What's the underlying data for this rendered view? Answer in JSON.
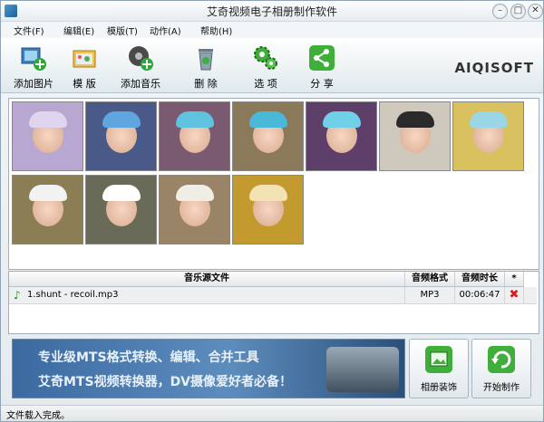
{
  "window": {
    "title": "艾奇视频电子相册制作软件"
  },
  "menu": [
    "文件(F)",
    "编辑(E)",
    "模版(T)",
    "动作(A)",
    "帮助(H)"
  ],
  "toolbar": [
    {
      "label": "添加图片",
      "icon": "add-photo-icon"
    },
    {
      "label": "模 版",
      "icon": "template-icon"
    },
    {
      "label": "添加音乐",
      "icon": "add-music-icon"
    },
    {
      "label": "删 除",
      "icon": "recycle-bin-icon"
    },
    {
      "label": "选 项",
      "icon": "gears-icon"
    },
    {
      "label": "分 享",
      "icon": "share-icon"
    }
  ],
  "brand": "AIQISOFT",
  "photos": [
    {
      "bg": "#b8a7d1",
      "hat": "#e0d4ef"
    },
    {
      "bg": "#4a5a88",
      "hat": "#5fa6e0"
    },
    {
      "bg": "#7a5a70",
      "hat": "#5fc2de"
    },
    {
      "bg": "#8a7a5a",
      "hat": "#4cb8d8"
    },
    {
      "bg": "#5e3f6a",
      "hat": "#6fd0e8"
    },
    {
      "bg": "#cfc8bc",
      "hat": "#2a2a2a"
    },
    {
      "bg": "#d9c160",
      "hat": "#9bd6e6"
    },
    {
      "bg": "#8c7e54",
      "hat": "#f2f2f2"
    },
    {
      "bg": "#6a6a58",
      "hat": "#ffffff"
    },
    {
      "bg": "#9a8468",
      "hat": "#f0ece6"
    },
    {
      "bg": "#c39a2e",
      "hat": "#f3e2b4"
    }
  ],
  "music_table": {
    "headers": [
      "音乐源文件",
      "音频格式",
      "音频时长",
      "*"
    ],
    "rows": [
      {
        "file": "1.shunt - recoil.mp3",
        "format": "MP3",
        "duration": "00:06:47"
      }
    ]
  },
  "banner": {
    "line1": "专业级MTS格式转换、编辑、合并工具",
    "line2": "艾奇MTS视频转换器，DV摄像爱好者必备！"
  },
  "actions": [
    {
      "label": "相册装饰",
      "icon": "decorate-icon"
    },
    {
      "label": "开始制作",
      "icon": "start-icon"
    }
  ],
  "status": "文件载入完成。"
}
